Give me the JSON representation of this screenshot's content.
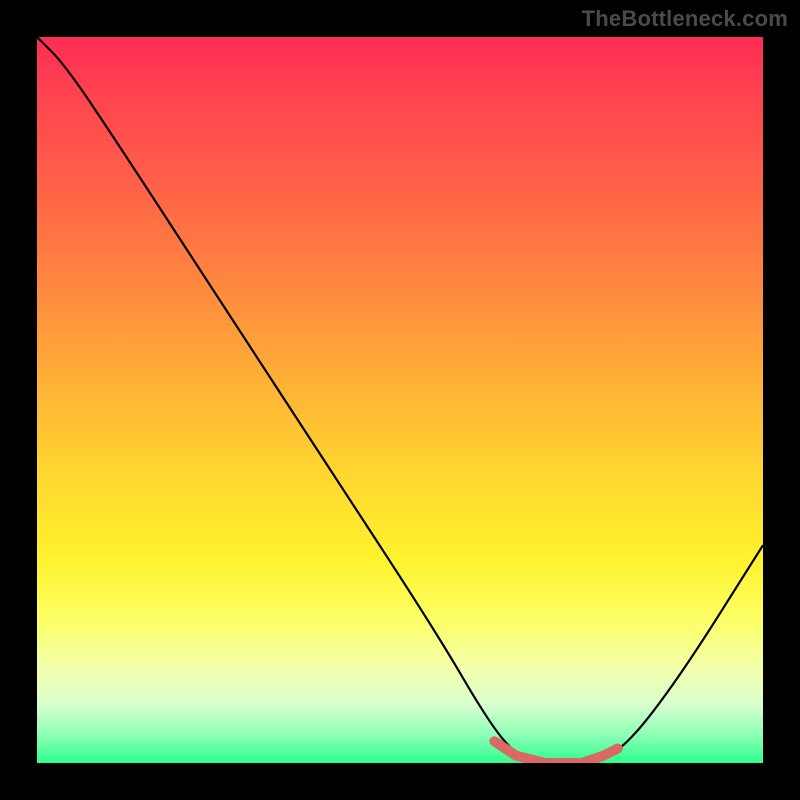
{
  "watermark": "TheBottleneck.com",
  "chart_data": {
    "type": "line",
    "title": "",
    "xlabel": "",
    "ylabel": "",
    "xlim": [
      0,
      100
    ],
    "ylim": [
      0,
      100
    ],
    "series": [
      {
        "name": "curve",
        "x": [
          0,
          4,
          12,
          25,
          40,
          55,
          62,
          66,
          70,
          75,
          80,
          88,
          100
        ],
        "y": [
          100,
          96,
          84,
          64,
          41,
          18,
          6,
          1,
          0,
          0,
          1,
          11,
          30
        ]
      },
      {
        "name": "highlight",
        "x": [
          63,
          66,
          70,
          75,
          78,
          80
        ],
        "y": [
          3,
          1,
          0,
          0,
          1,
          2
        ]
      }
    ],
    "colors": {
      "curve": "#000000",
      "highlight": "#d96a63",
      "gradient_top": "#ff2c55",
      "gradient_bottom": "#2eff8c"
    }
  }
}
